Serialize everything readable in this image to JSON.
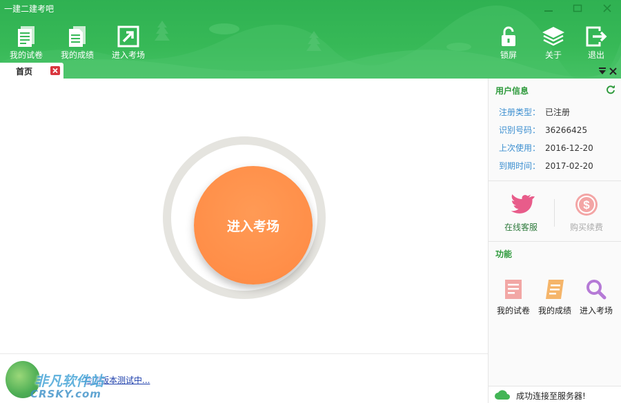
{
  "app": {
    "title": "一建二建考吧"
  },
  "toolbar": {
    "left": [
      {
        "label": "我的试卷",
        "icon": "document-icon"
      },
      {
        "label": "我的成绩",
        "icon": "report-icon"
      },
      {
        "label": "进入考场",
        "icon": "enter-arrow-icon"
      }
    ],
    "right": [
      {
        "label": "锁屏",
        "icon": "lock-icon"
      },
      {
        "label": "关于",
        "icon": "layers-icon"
      },
      {
        "label": "退出",
        "icon": "exit-icon"
      }
    ]
  },
  "tabs": [
    {
      "label": "首页",
      "active": true
    }
  ],
  "main": {
    "enter_button_label": "进入考场",
    "status_link": "检测版本测试中..."
  },
  "watermark": {
    "text": "非凡软件站",
    "sub": "CRSKY.com"
  },
  "side": {
    "user_info_title": "用户信息",
    "info": [
      {
        "key": "注册类型：",
        "value": "已注册"
      },
      {
        "key": "识别号码：",
        "value": "36266425"
      },
      {
        "key": "上次使用：",
        "value": "2016-12-20"
      },
      {
        "key": "到期时间：",
        "value": "2017-02-20"
      }
    ],
    "actions": [
      {
        "label": "在线客服",
        "icon": "bird-icon",
        "enabled": true
      },
      {
        "label": "购买续费",
        "icon": "dollar-icon",
        "enabled": false
      }
    ],
    "functions_title": "功能",
    "functions": [
      {
        "label": "我的试卷",
        "icon": "document-icon"
      },
      {
        "label": "我的成绩",
        "icon": "report-icon"
      },
      {
        "label": "进入考场",
        "icon": "search-icon"
      }
    ],
    "server_status": "成功连接至服务器!"
  },
  "colors": {
    "header_green": "#37b957",
    "accent_orange": "#ff8e48",
    "side_title_green": "#2e9a3c",
    "info_key_blue": "#3b8ed0"
  }
}
